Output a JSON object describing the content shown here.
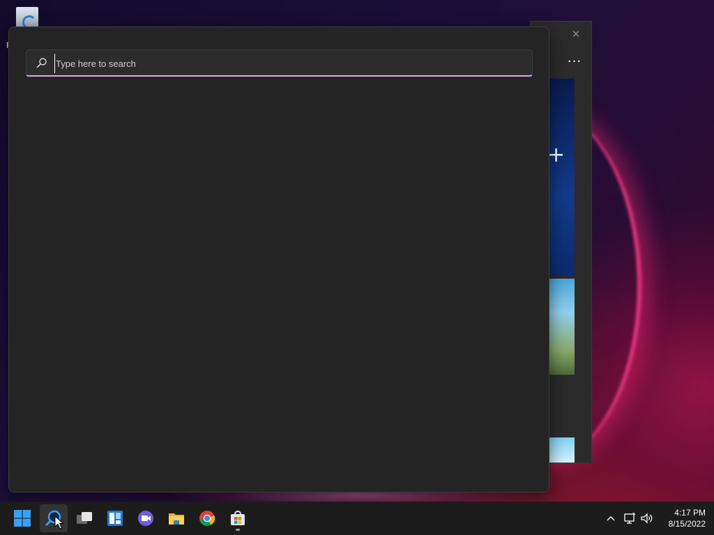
{
  "desktop": {
    "recycle_bin_label": "R"
  },
  "background_window": {
    "close_glyph": "✕",
    "more_glyph": "···",
    "add_glyph": "+"
  },
  "search": {
    "placeholder": "Type here to search",
    "value": "",
    "accent_color": "#e4a8df"
  },
  "taskbar": {
    "items": [
      {
        "name": "start",
        "icon": "windows-logo-icon"
      },
      {
        "name": "search",
        "icon": "search-icon",
        "active": true
      },
      {
        "name": "task-view",
        "icon": "task-view-icon"
      },
      {
        "name": "widgets",
        "icon": "widgets-icon"
      },
      {
        "name": "chat",
        "icon": "teams-chat-icon"
      },
      {
        "name": "file-explorer",
        "icon": "folder-icon"
      },
      {
        "name": "chrome",
        "icon": "chrome-icon"
      },
      {
        "name": "store",
        "icon": "microsoft-store-icon",
        "running": true
      }
    ],
    "tray": {
      "chevron": "^",
      "time": "4:17 PM",
      "date": "8/15/2022"
    }
  }
}
